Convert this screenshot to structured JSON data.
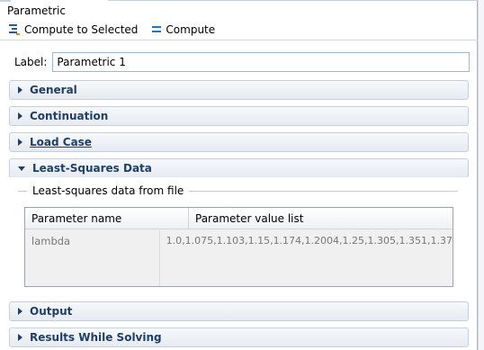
{
  "window": {
    "title": "Parametric"
  },
  "toolbar": {
    "compute_selected_label": "Compute to Selected",
    "compute_label": "Compute"
  },
  "label_field": {
    "label": "Label:",
    "value": "Parametric 1"
  },
  "sections": {
    "general": "General",
    "continuation": "Continuation",
    "load_case": "Load Case",
    "least_squares": "Least-Squares Data",
    "output": "Output",
    "results_while_solving": "Results While Solving"
  },
  "least_squares": {
    "group_label": "Least-squares data from file",
    "table": {
      "headers": [
        "Parameter name",
        "Parameter value list"
      ],
      "rows": [
        [
          "lambda",
          "1.0,1.075,1.103,1.15,1.174,1.2004,1.25,1.305,1.351,1.37"
        ]
      ]
    }
  },
  "colors": {
    "section_text": "#1f3f66",
    "section_border": "#c5d0dc",
    "icon_blue": "#2376b9"
  },
  "icons": [
    "compute-to-selected-icon",
    "compute-icon",
    "chevron-right-icon",
    "chevron-down-icon"
  ]
}
